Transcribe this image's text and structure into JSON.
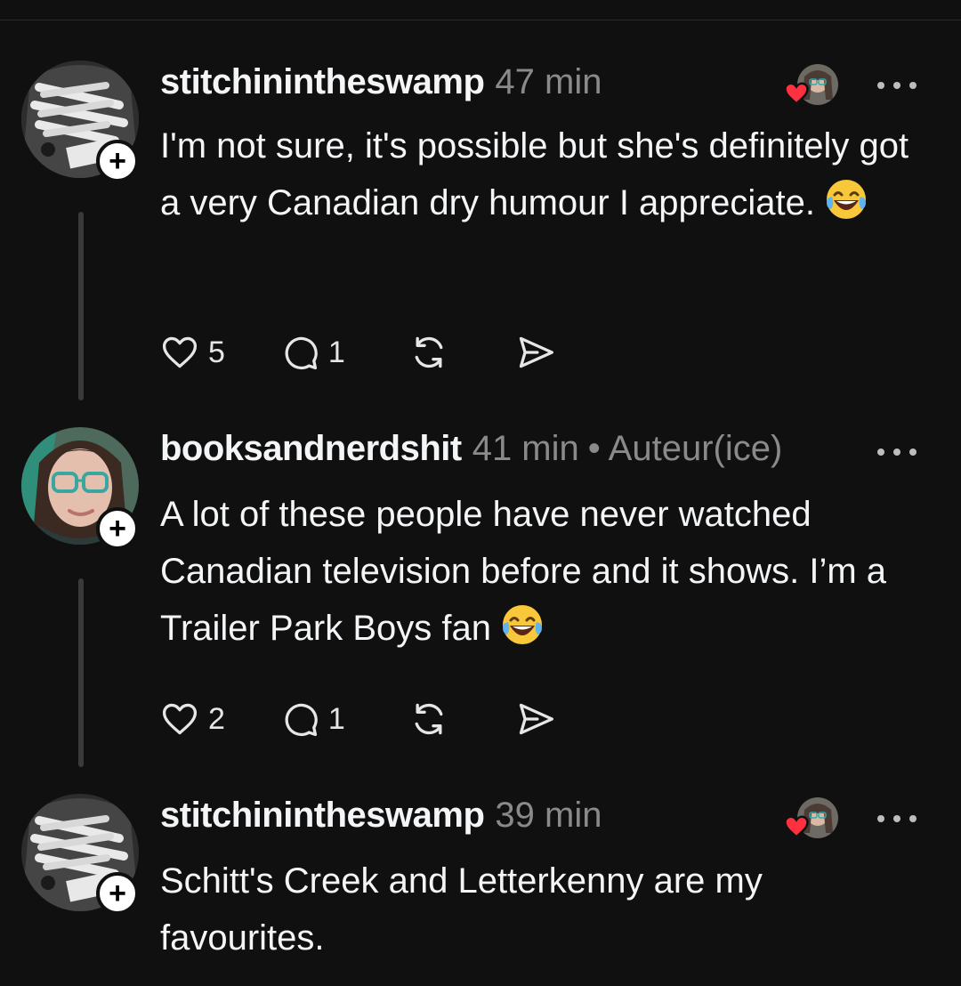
{
  "posts": [
    {
      "username": "stitchinintheswamp",
      "time": "47 min",
      "text": "I'm not sure, it's possible but she's definitely got a very Canadian dry humour I appreciate.",
      "emoji": "face-with-tears-of-joy",
      "likes": "5",
      "replies": "1",
      "liked_by_author": true
    },
    {
      "username": "booksandnerdshit",
      "time": "41 min",
      "role": "• Auteur(ice)",
      "text": "A lot of these people have never watched Canadian television before and it shows. I’m a Trailer Park Boys fan",
      "emoji": "face-with-tears-of-joy",
      "likes": "2",
      "replies": "1"
    },
    {
      "username": "stitchinintheswamp",
      "time": "39 min",
      "text": "Schitt's Creek and Letterkenny are my favourites.",
      "liked_by_author": true
    }
  ],
  "colors": {
    "background": "#101010",
    "text": "#f3f5f7",
    "muted": "#8a8a8a",
    "heart": "#ff3040"
  }
}
